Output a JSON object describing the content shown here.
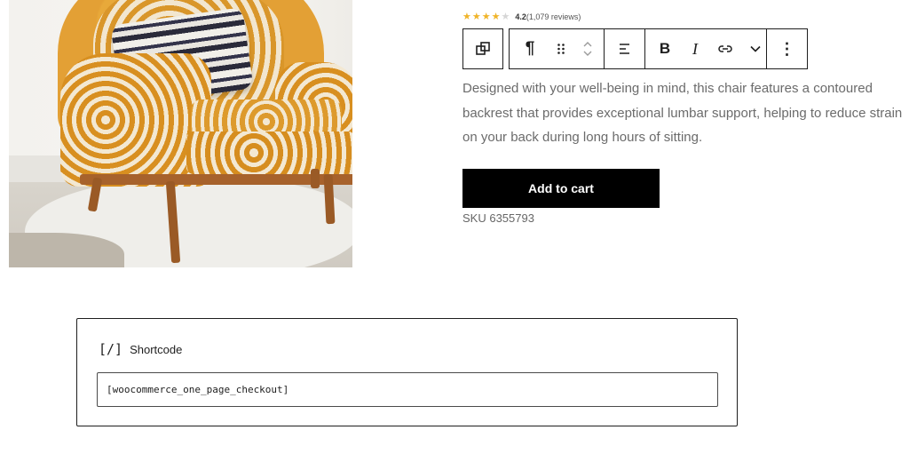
{
  "product": {
    "rating_value": "4.2",
    "rating_stars": 4.2,
    "review_count_text": "(1,079 reviews)",
    "description": "Designed with your well-being in mind, this chair features a contoured backrest that provides exceptional lumbar support, helping to reduce strain on your back during long hours of sitting.",
    "add_to_cart_label": "Add to cart",
    "sku_text": "SKU 6355793"
  },
  "toolbar": {
    "paragraph_glyph": "¶",
    "drag_glyph": "⠿",
    "bold_label": "B",
    "italic_label": "I",
    "more_glyph": "⋮",
    "chevron_glyph": "⌄"
  },
  "shortcode": {
    "icon_text": "[/]",
    "label": "Shortcode",
    "value": "[woocommerce_one_page_checkout]"
  },
  "colors": {
    "star_filled": "#f0b429",
    "button_bg": "#000000",
    "text_muted": "#6b6b6b"
  }
}
